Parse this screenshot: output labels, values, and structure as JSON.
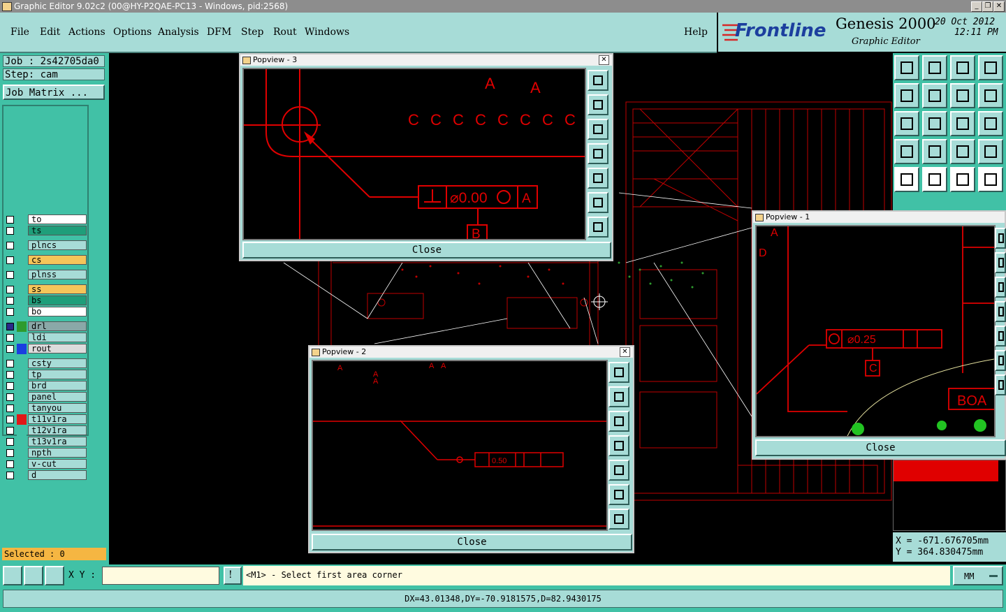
{
  "window": {
    "title": "Graphic Editor 9.02c2 (00@HY-P2QAE-PC13 - Windows, pid:2568)"
  },
  "menu": {
    "items": [
      "File",
      "Edit",
      "Actions",
      "Options",
      "Analysis",
      "DFM",
      "Step",
      "Rout",
      "Windows"
    ],
    "help": "Help"
  },
  "brand": {
    "logo": "Frontline",
    "product": "Genesis 2000",
    "subtitle": "Graphic Editor",
    "date": "20 Oct 2012",
    "time": "12:11 PM"
  },
  "job": {
    "job_label": "Job : 2s42705da0",
    "step_label": "Step: cam",
    "matrix_button": "Job Matrix ..."
  },
  "layers": [
    {
      "name": "to",
      "color": "#ffffff",
      "icon": ""
    },
    {
      "name": "ts",
      "color": "#1f9e7a",
      "icon": "✐"
    },
    {
      "name": "plncs",
      "color": "#a7dcd7",
      "icon": ""
    },
    {
      "name": "cs",
      "color": "#f5c55a",
      "icon": "✐"
    },
    {
      "name": "plnss",
      "color": "#a7dcd7",
      "icon": ""
    },
    {
      "name": "ss",
      "color": "#f5c55a",
      "icon": ""
    },
    {
      "name": "bs",
      "color": "#1f9e7a",
      "icon": "✐"
    },
    {
      "name": "bo",
      "color": "#ffffff",
      "icon": ""
    },
    {
      "name": "drl",
      "color": "#8aa8a8",
      "icon": "⊞"
    },
    {
      "name": "ldi",
      "color": "#a7dcd7",
      "icon": ""
    },
    {
      "name": "rout",
      "color": "#dcdcdc",
      "icon": ""
    },
    {
      "name": "csty",
      "color": "#a7dcd7",
      "icon": ""
    },
    {
      "name": "tp",
      "color": "#a7dcd7",
      "icon": "✐"
    },
    {
      "name": "brd",
      "color": "#a7dcd7",
      "icon": ""
    },
    {
      "name": "panel",
      "color": "#a7dcd7",
      "icon": "✐"
    },
    {
      "name": "tanyou",
      "color": "#a7dcd7",
      "icon": ""
    },
    {
      "name": "t11v1ra",
      "color": "#a7dcd7",
      "icon": ""
    },
    {
      "name": "t12v1ra",
      "color": "#a7dcd7",
      "icon": ""
    },
    {
      "name": "t13v1ra",
      "color": "#a7dcd7",
      "icon": ""
    },
    {
      "name": "npth",
      "color": "#a7dcd7",
      "icon": ""
    },
    {
      "name": "v-cut",
      "color": "#a7dcd7",
      "icon": ""
    },
    {
      "name": "d",
      "color": "#a7dcd7",
      "icon": ""
    }
  ],
  "selected": "Selected : 0",
  "popups": {
    "p3": {
      "title": "Popview - 3",
      "close": "Close",
      "fcf": "⌀0.00",
      "datum": "A",
      "datum_b": "B"
    },
    "p2": {
      "title": "Popview - 2",
      "close": "Close",
      "fcf": "0.50"
    },
    "p1": {
      "title": "Popview - 1",
      "close": "Close",
      "fcf": "⌀0.25",
      "datum_c": "C",
      "board_text": "BOA"
    }
  },
  "coords": {
    "x": "X = -671.676705mm",
    "y": "Y = 364.830475mm"
  },
  "bottom": {
    "xy_label": "X Y :",
    "xy_value": "",
    "prompt": "<M1> - Select first area corner",
    "units": "MM",
    "status": "DX=43.01348,DY=-70.9181575,D=82.9430175"
  },
  "colors": {
    "panel": "#41c1a6",
    "light": "#a7dcd7",
    "drawing": "#e00000"
  }
}
